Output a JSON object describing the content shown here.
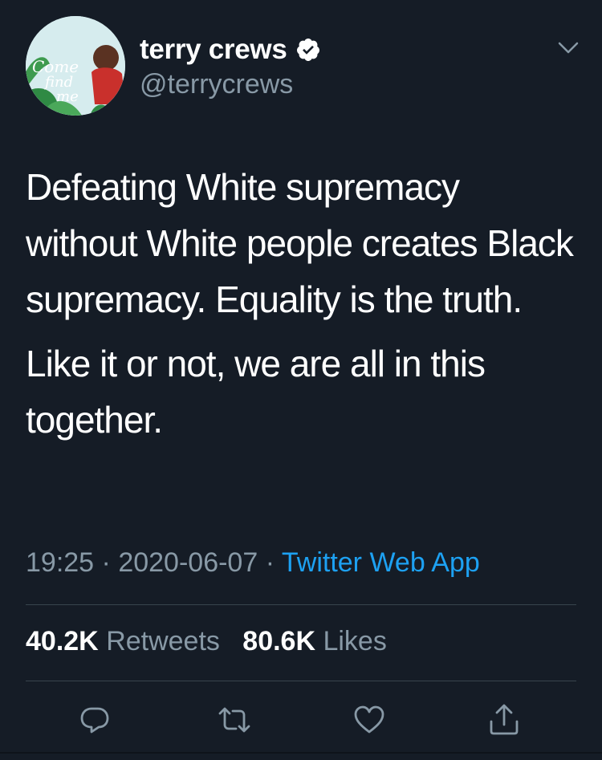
{
  "user": {
    "display_name": "terry crews",
    "handle": "@terrycrews",
    "avatar_cover_text": "Come find me"
  },
  "tweet": {
    "paragraphs": [
      "Defeating White supremacy without White people creates Black supremacy. Equality is the truth.",
      "Like it or not, we are all in this together."
    ],
    "time": "19:25",
    "date": "2020-06-07",
    "separator": "·",
    "source": "Twitter Web App"
  },
  "stats": {
    "retweets_count": "40.2K",
    "retweets_label": "Retweets",
    "likes_count": "80.6K",
    "likes_label": "Likes"
  },
  "icons": {
    "verified": "verified-badge-icon",
    "menu": "chevron-down-icon",
    "reply": "reply-icon",
    "retweet": "retweet-icon",
    "like": "heart-icon",
    "share": "share-icon"
  },
  "colors": {
    "background": "#151c26",
    "text": "#ffffff",
    "muted": "#8899a6",
    "link": "#1da1f2",
    "divider": "#38444d"
  }
}
